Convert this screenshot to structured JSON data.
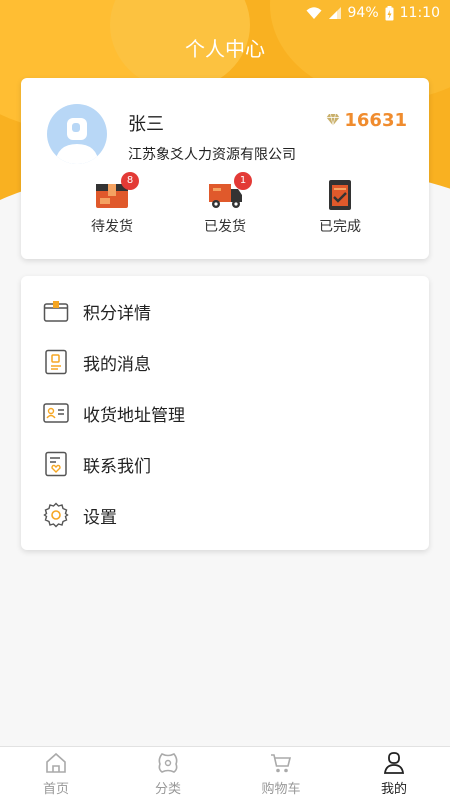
{
  "status_bar": {
    "battery": "94%",
    "time": "11:10"
  },
  "page_title": "个人中心",
  "profile": {
    "name": "张三",
    "company": "江苏象爻人力资源有限公司",
    "points": "16631"
  },
  "orders": [
    {
      "label": "待发货",
      "badge": "8"
    },
    {
      "label": "已发货",
      "badge": "1"
    },
    {
      "label": "已完成",
      "badge": ""
    }
  ],
  "menu": [
    {
      "label": "积分详情",
      "icon": "points-card-icon"
    },
    {
      "label": "我的消息",
      "icon": "message-icon"
    },
    {
      "label": "收货地址管理",
      "icon": "address-card-icon"
    },
    {
      "label": "联系我们",
      "icon": "contact-icon"
    },
    {
      "label": "设置",
      "icon": "gear-icon"
    }
  ],
  "bottom_nav": [
    {
      "label": "首页",
      "icon": "home-icon",
      "active": false
    },
    {
      "label": "分类",
      "icon": "category-icon",
      "active": false
    },
    {
      "label": "购物车",
      "icon": "cart-icon",
      "active": false
    },
    {
      "label": "我的",
      "icon": "user-icon",
      "active": true
    }
  ],
  "colors": {
    "header": "#f9b121",
    "points": "#f08c2e",
    "badge": "#e33a36",
    "order_icon": "#e0592b"
  }
}
